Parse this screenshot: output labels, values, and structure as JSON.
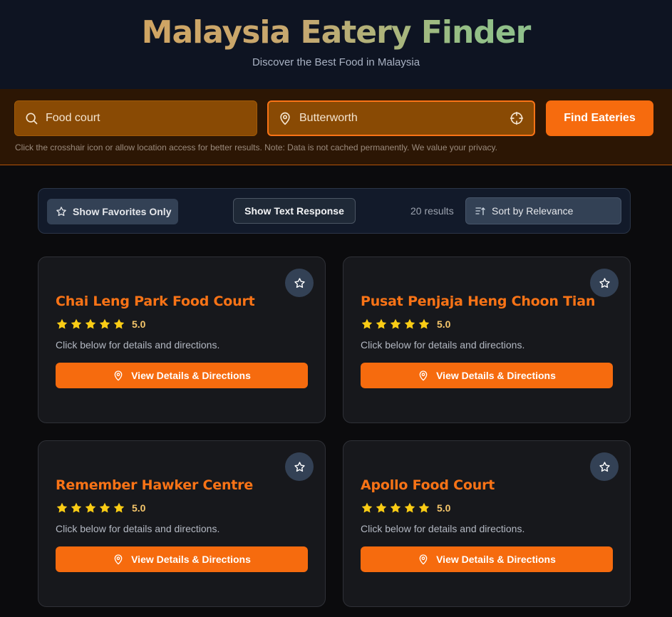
{
  "header": {
    "title": "Malaysia Eatery Finder",
    "subtitle": "Discover the Best Food in Malaysia"
  },
  "search": {
    "food_value": "Food court",
    "location_value": "Butterworth",
    "find_label": "Find Eateries",
    "note": "Click the crosshair icon or allow location access for better results. Note: Data is not cached permanently. We value your privacy."
  },
  "toolbar": {
    "favorites_label": "Show Favorites Only",
    "text_response_label": "Show Text Response",
    "results_count": "20 results",
    "sort_label": "Sort by Relevance"
  },
  "cards": [
    {
      "name": "Chai Leng Park Food Court",
      "rating": "5.0",
      "stars": 5,
      "description": "Click below for details and directions.",
      "button_label": "View Details & Directions"
    },
    {
      "name": "Pusat Penjaja Heng Choon Tian",
      "rating": "5.0",
      "stars": 5,
      "description": "Click below for details and directions.",
      "button_label": "View Details & Directions"
    },
    {
      "name": "Remember Hawker Centre",
      "rating": "5.0",
      "stars": 5,
      "description": "Click below for details and directions.",
      "button_label": "View Details & Directions"
    },
    {
      "name": "Apollo Food Court",
      "rating": "5.0",
      "stars": 5,
      "description": "Click below for details and directions.",
      "button_label": "View Details & Directions"
    }
  ],
  "icons": {
    "search": "search-icon",
    "location": "map-pin-icon",
    "crosshair": "crosshair-icon",
    "favorite": "star-outline-icon",
    "sort": "sort-ascending-icon",
    "rating": "star-filled-icon"
  },
  "colors": {
    "accent": "#f66b0e",
    "card_title": "#f97316",
    "rating_star": "#facc15",
    "rating_text": "#f5c66b"
  }
}
